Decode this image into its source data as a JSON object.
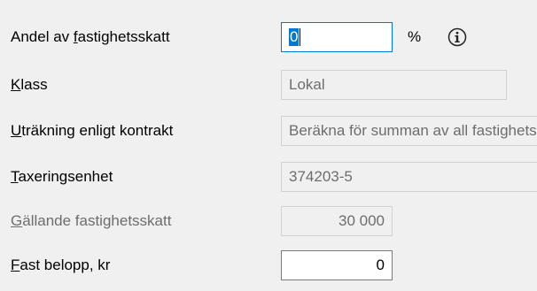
{
  "form": {
    "share_label": {
      "pre": "Andel av ",
      "underline": "f",
      "post": "astighetsskatt"
    },
    "share_value": "0",
    "share_unit": "%",
    "info_icon": "info-circle-icon",
    "class_label": {
      "pre": "",
      "underline": "K",
      "post": "lass"
    },
    "class_value": "Lokal",
    "calc_label": {
      "pre": "",
      "underline": "U",
      "post": "träkning enligt kontrakt"
    },
    "calc_value": "Beräkna för summan av all fastighetsskatt",
    "unit_label": {
      "pre": "",
      "underline": "T",
      "post": "axeringsenhet"
    },
    "unit_value": "374203-5",
    "current_tax_label": {
      "pre": "",
      "underline": "G",
      "post": "ällande fastighetsskatt"
    },
    "current_tax_value": "30 000",
    "fixed_amount_label": {
      "pre": "",
      "underline": "F",
      "post": "ast belopp, kr"
    },
    "fixed_amount_value": "0"
  },
  "colors": {
    "background": "#f0f0f0",
    "selection": "#0078d7",
    "focus_border": "#0078d7",
    "disabled_text": "#6d6d6d"
  }
}
